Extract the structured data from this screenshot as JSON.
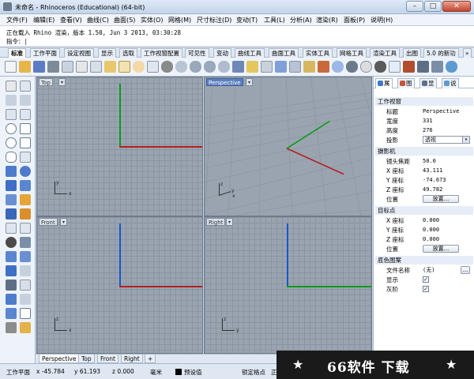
{
  "window": {
    "title": "未命名 - Rhinoceros (Educational) (64-bit)",
    "minimize_glyph": "–",
    "maximize_glyph": "□",
    "close_glyph": "✕"
  },
  "menu": [
    "文件(F)",
    "编辑(E)",
    "查看(V)",
    "曲线(C)",
    "曲面(S)",
    "实体(O)",
    "网格(M)",
    "尺寸标注(D)",
    "变动(T)",
    "工具(L)",
    "分析(A)",
    "渲染(R)",
    "面板(P)",
    "说明(H)"
  ],
  "command": {
    "history": "正在载入 Rhino 渲染，版本 1.50, Jun  3 2013, 03:30:28",
    "prompt": "指令："
  },
  "toolbar_tabs": [
    "标准",
    "工作平面",
    "设定视图",
    "显示",
    "选取",
    "工作视窗配置",
    "可见性",
    "变动",
    "曲线工具",
    "曲面工具",
    "实体工具",
    "网格工具",
    "渲染工具",
    "出图",
    "5.0 的新功"
  ],
  "toolbar_tabs_overflow": "»",
  "viewports": {
    "top": "Top",
    "perspective": "Perspective",
    "front": "Front",
    "right": "Right",
    "dropdown_glyph": "▾",
    "axis_x": "x",
    "axis_y": "y",
    "axis_z": "z"
  },
  "viewport_tabs": [
    "Perspective",
    "Top",
    "Front",
    "Right"
  ],
  "viewport_tab_add": "+",
  "panel": {
    "tabs": [
      "属",
      "图",
      "显",
      "说"
    ],
    "sections": {
      "viewport": "工作视窗",
      "camera": "摄影机",
      "target": "目标点",
      "wallpaper": "底色图案"
    },
    "viewport_props": [
      {
        "k": "标题",
        "v": "Perspective"
      },
      {
        "k": "宽度",
        "v": "331"
      },
      {
        "k": "高度",
        "v": "276"
      }
    ],
    "projection_label": "投影",
    "projection_value": "透视",
    "camera_props": [
      {
        "k": "镜头焦距",
        "v": "50.0"
      },
      {
        "k": "X 座标",
        "v": "43.111"
      },
      {
        "k": "Y 座标",
        "v": "-74.673"
      },
      {
        "k": "Z 座标",
        "v": "49.782"
      }
    ],
    "location_label": "位置",
    "place_button": "放置...",
    "target_props": [
      {
        "k": "X 座标",
        "v": "0.000"
      },
      {
        "k": "Y 座标",
        "v": "0.000"
      },
      {
        "k": "Z 座标",
        "v": "0.000"
      }
    ],
    "file_label": "文件名称",
    "file_value": "(无)",
    "browse_button": "...",
    "show_label": "显示",
    "gray_label": "灰阶",
    "check_glyph": "✓",
    "select_arrow": "▾"
  },
  "status": {
    "cplane": "工作平面",
    "x": "x -45.784",
    "y": "y 61.193",
    "z": "z 0.000",
    "unit": "毫米",
    "layer": "预设值",
    "lock": "锁定格点",
    "extra": "正"
  },
  "watermark": {
    "text": "66软件 下载",
    "star": "★"
  }
}
